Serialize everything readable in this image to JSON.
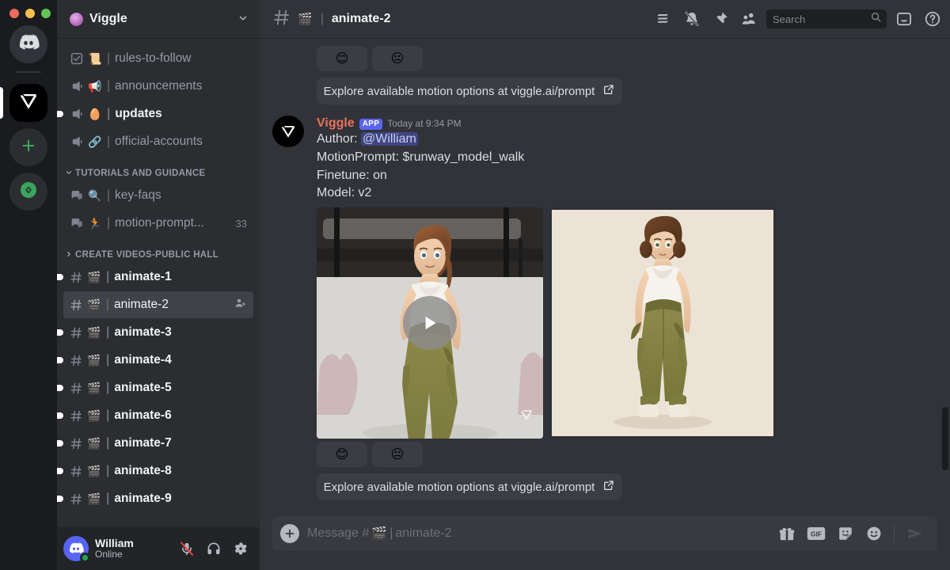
{
  "window": {
    "traffic_lights": [
      "close",
      "minimize",
      "maximize"
    ]
  },
  "server_rail": {
    "items": [
      {
        "name": "home",
        "label": "Home",
        "icon": "discord-logo-icon"
      },
      {
        "name": "viggle",
        "label": "Viggle",
        "icon": "viggle-logo-icon",
        "active": true
      },
      {
        "name": "add-server",
        "label": "Add a Server",
        "icon": "plus-icon"
      },
      {
        "name": "explore",
        "label": "Explore Discoverable Servers",
        "icon": "compass-icon"
      }
    ]
  },
  "sidebar": {
    "server_name": "Viggle",
    "channels_top": [
      {
        "name": "rules-to-follow",
        "label": "rules-to-follow",
        "type": "rules",
        "emoji": "📜",
        "unread": false
      },
      {
        "name": "announcements",
        "label": "announcements",
        "type": "announcement",
        "emoji": "📢",
        "unread": false
      },
      {
        "name": "updates",
        "label": "updates",
        "type": "announcement",
        "emoji": "🥚",
        "unread": true
      },
      {
        "name": "official-accounts",
        "label": "official-accounts",
        "type": "announcement",
        "emoji": "🔗",
        "unread": false
      }
    ],
    "categories": [
      {
        "label": "TUTORIALS AND GUIDANCE",
        "expanded": true,
        "channels": [
          {
            "name": "key-faqs",
            "label": "key-faqs",
            "type": "forum",
            "emoji": "🔍",
            "unread": false,
            "count": ""
          },
          {
            "name": "motion-prompt",
            "label": "motion-prompt...",
            "type": "forum",
            "emoji": "🏃",
            "unread": false,
            "count": "33"
          }
        ]
      },
      {
        "label": "CREATE VIDEOS-PUBLIC HALL",
        "expanded": false,
        "channels": [
          {
            "name": "animate-1",
            "label": "animate-1",
            "type": "text",
            "emoji": "🎬",
            "unread": true,
            "count": ""
          },
          {
            "name": "animate-2",
            "label": "animate-2",
            "type": "text",
            "emoji": "🎬",
            "unread": false,
            "active": true,
            "count": ""
          },
          {
            "name": "animate-3",
            "label": "animate-3",
            "type": "text",
            "emoji": "🎬",
            "unread": true,
            "count": ""
          },
          {
            "name": "animate-4",
            "label": "animate-4",
            "type": "text",
            "emoji": "🎬",
            "unread": true,
            "count": ""
          },
          {
            "name": "animate-5",
            "label": "animate-5",
            "type": "text",
            "emoji": "🎬",
            "unread": true,
            "count": ""
          },
          {
            "name": "animate-6",
            "label": "animate-6",
            "type": "text",
            "emoji": "🎬",
            "unread": true,
            "count": ""
          },
          {
            "name": "animate-7",
            "label": "animate-7",
            "type": "text",
            "emoji": "🎬",
            "unread": true,
            "count": ""
          },
          {
            "name": "animate-8",
            "label": "animate-8",
            "type": "text",
            "emoji": "🎬",
            "unread": true,
            "count": ""
          },
          {
            "name": "animate-9",
            "label": "animate-9",
            "type": "text",
            "emoji": "🎬",
            "unread": true,
            "count": ""
          }
        ]
      }
    ]
  },
  "user_panel": {
    "username": "William",
    "status": "Online",
    "mic_state": "muted",
    "deafen_state": "on",
    "settings_label": "User Settings"
  },
  "topbar": {
    "channel_emoji": "🎬",
    "channel_name": "animate-2",
    "icons": [
      "threads-icon",
      "bell-muted-icon",
      "pin-icon",
      "members-icon",
      "inbox-icon",
      "help-icon"
    ]
  },
  "search": {
    "placeholder": "Search"
  },
  "messages": {
    "previous_partial": {
      "reactions": [
        "😊",
        "😐"
      ],
      "link_button": "Explore available motion options at viggle.ai/prompt"
    },
    "main": {
      "author": "Viggle",
      "app_tag": "APP",
      "timestamp": "Today at 9:34 PM",
      "lines": [
        {
          "prefix": "Author: ",
          "mention": "@William"
        },
        {
          "text": "MotionPrompt: $runway_model_walk"
        },
        {
          "text": "Finetune: on"
        },
        {
          "text": "Model: v2"
        }
      ],
      "attachments": [
        {
          "name": "generated-video",
          "kind": "video",
          "alt": "Animated 3D woman in white tank top and olive cargo pants walking on a runway"
        },
        {
          "name": "source-character",
          "kind": "image",
          "alt": "Illustrated character in white crop top and olive cargo pants on cream background"
        }
      ],
      "reactions": [
        "😊",
        "😐"
      ],
      "link_button": "Explore available motion options at viggle.ai/prompt"
    }
  },
  "composer": {
    "placeholder_prefix": "Message #",
    "placeholder_emoji": "🎬",
    "placeholder_suffix": "animate-2",
    "icons": [
      "gift-icon",
      "gif-icon",
      "sticker-icon",
      "emoji-icon",
      "send-icon"
    ],
    "gif_label": "GIF"
  },
  "colors": {
    "accent": "#5865f2",
    "bot_name": "#e8715c",
    "online": "#23a55a",
    "sidebar_bg": "#2b2d31",
    "main_bg": "#313338",
    "rail_bg": "#1a1b1e"
  }
}
